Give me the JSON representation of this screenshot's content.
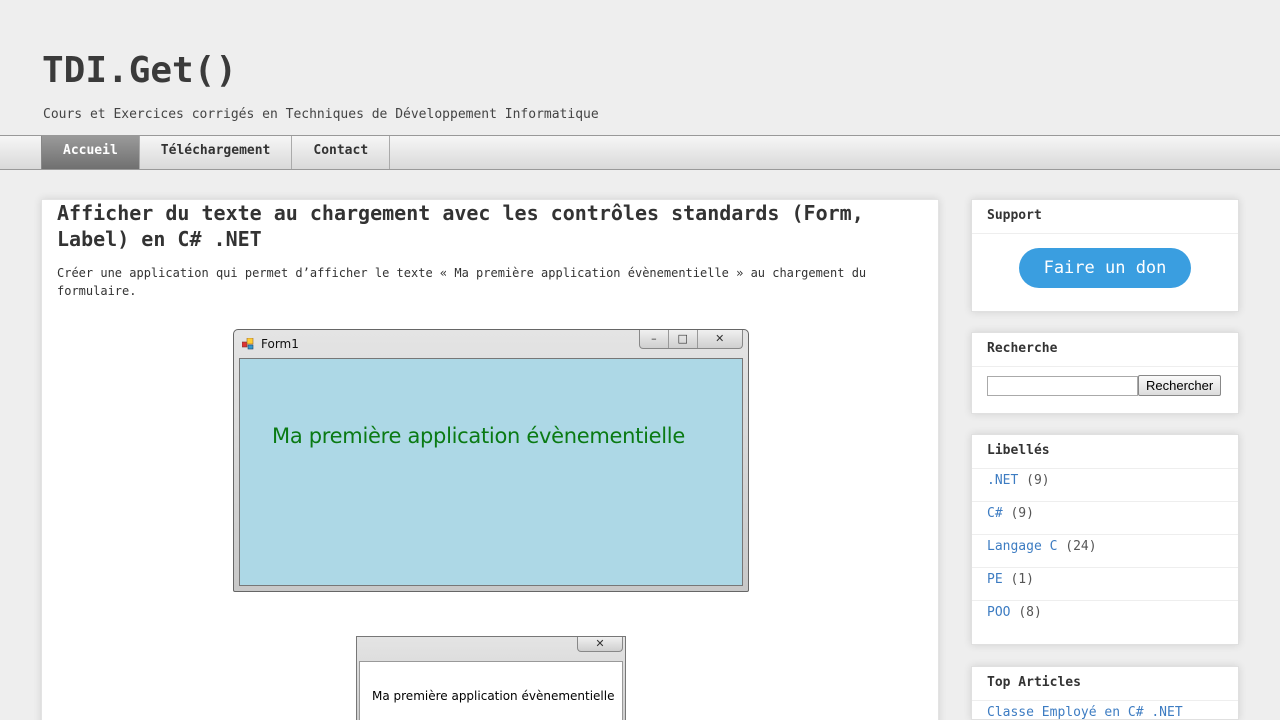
{
  "header": {
    "title": "TDI.Get()",
    "description": "Cours et Exercices corrigés en Techniques de Développement Informatique"
  },
  "nav": {
    "items": [
      {
        "label": "Accueil",
        "active": true
      },
      {
        "label": "Téléchargement",
        "active": false
      },
      {
        "label": "Contact",
        "active": false
      }
    ]
  },
  "post": {
    "title": "Afficher du texte au chargement avec les contrôles standards (Form, Label) en C# .NET",
    "body": "Créer une application qui permet d’afficher le texte « Ma première application évènementielle » au chargement du formulaire.",
    "form_window": {
      "title": "Form1",
      "label_text": "Ma première application évènementielle",
      "client_color": "#add8e6",
      "label_color": "#0a7a14"
    },
    "message_box": {
      "text": "Ma première application évènementielle"
    }
  },
  "sidebar": {
    "support": {
      "title": "Support",
      "button_label": "Faire un don",
      "button_color": "#3a9ee0"
    },
    "search": {
      "title": "Recherche",
      "placeholder": "",
      "button_label": "Rechercher"
    },
    "labels": {
      "title": "Libellés",
      "items": [
        {
          "name": ".NET",
          "count": "(9)"
        },
        {
          "name": "C#",
          "count": "(9)"
        },
        {
          "name": "Langage C",
          "count": "(24)"
        },
        {
          "name": "PE",
          "count": "(1)"
        },
        {
          "name": "POO",
          "count": "(8)"
        }
      ]
    },
    "top_articles": {
      "title": "Top Articles",
      "items": [
        "Classe Employé en C# .NET"
      ]
    }
  }
}
